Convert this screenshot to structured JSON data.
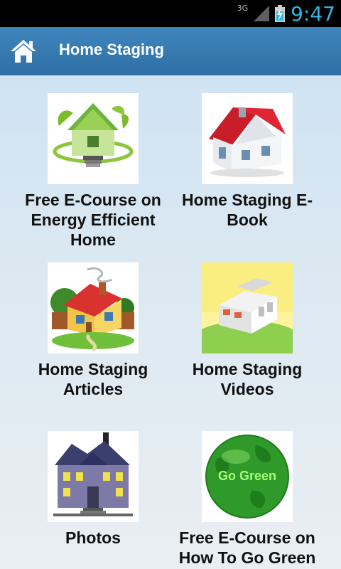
{
  "status_bar": {
    "network": "3G",
    "time": "9:47"
  },
  "action_bar": {
    "title": "Home Staging",
    "icon": "home-icon"
  },
  "tiles": [
    {
      "label": "Free E-Course on Energy Efficient Home",
      "icon": "green-house-icon"
    },
    {
      "label": "Home Staging E-Book",
      "icon": "house-icon"
    },
    {
      "label": "Home Staging Articles",
      "icon": "cottage-icon"
    },
    {
      "label": "Home Staging Videos",
      "icon": "modern-house-icon"
    },
    {
      "label": "Photos",
      "icon": "mansion-icon"
    },
    {
      "label": "Free E-Course on How To Go Green",
      "icon": "globe-icon",
      "badge": "Go Green"
    }
  ]
}
